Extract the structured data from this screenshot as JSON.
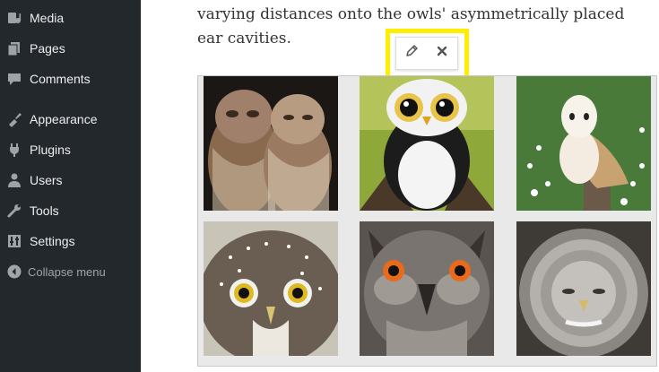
{
  "sidebar": {
    "items": [
      {
        "label": "Media",
        "icon": "media-icon"
      },
      {
        "label": "Pages",
        "icon": "pages-icon"
      },
      {
        "label": "Comments",
        "icon": "comments-icon"
      },
      {
        "label": "Appearance",
        "icon": "appearance-icon"
      },
      {
        "label": "Plugins",
        "icon": "plugins-icon"
      },
      {
        "label": "Users",
        "icon": "users-icon"
      },
      {
        "label": "Tools",
        "icon": "tools-icon"
      },
      {
        "label": "Settings",
        "icon": "settings-icon"
      }
    ],
    "collapse_label": "Collapse menu"
  },
  "editor": {
    "paragraph": "varying distances onto the owls' asymmetrically placed ear cavities.",
    "gallery_toolbar": {
      "edit_icon": "pencil-icon",
      "remove_icon": "close-icon"
    },
    "gallery": [
      {
        "subject": "two tawny owls"
      },
      {
        "subject": "plush toy owl"
      },
      {
        "subject": "barn owl"
      },
      {
        "subject": "pygmy owl face"
      },
      {
        "subject": "eagle owl face"
      },
      {
        "subject": "great grey owl face"
      }
    ]
  },
  "colors": {
    "sidebar_bg": "#23282d",
    "highlight": "#ffee00",
    "gallery_bg": "#e9e9e9"
  }
}
